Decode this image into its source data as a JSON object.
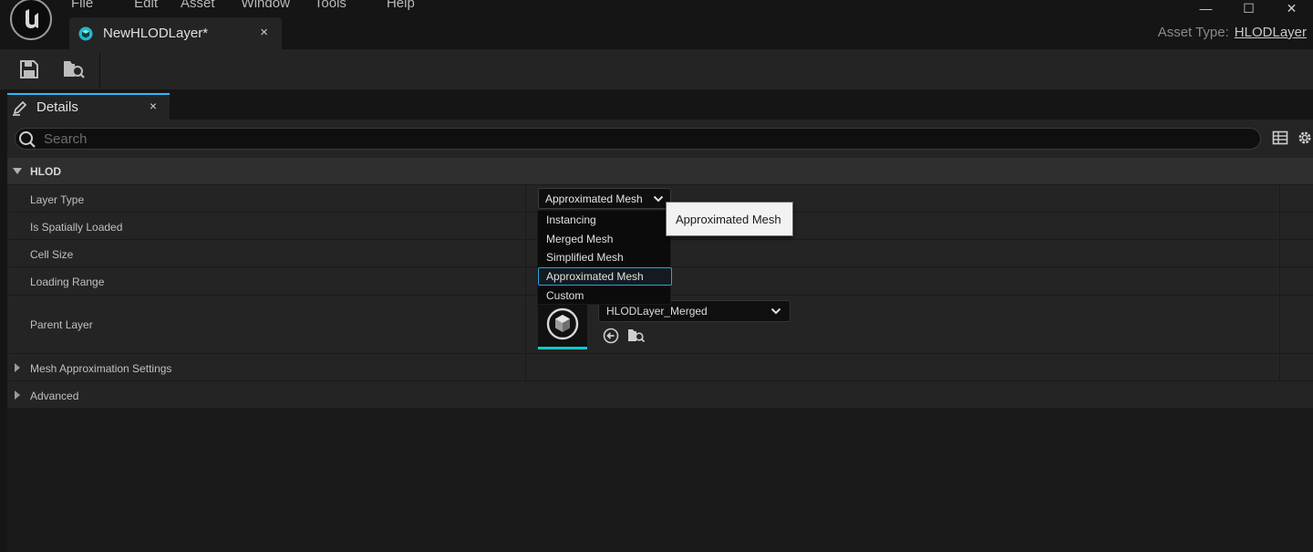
{
  "menu": [
    "File",
    "Edit",
    "Asset",
    "Window",
    "Tools",
    "Help"
  ],
  "document_tab": {
    "label": "NewHLODLayer*",
    "close": "×"
  },
  "window_controls": {
    "minimize": "—",
    "maximize": "☐",
    "close": "✕"
  },
  "asset_type": {
    "label": "Asset Type:",
    "value": "HLODLayer"
  },
  "details_tab": {
    "label": "Details",
    "close": "×"
  },
  "search": {
    "placeholder": "Search",
    "value": ""
  },
  "category": {
    "label": "HLOD"
  },
  "properties": {
    "layer_type": {
      "label": "Layer Type",
      "value": "Approximated Mesh"
    },
    "is_spatially_loaded": {
      "label": "Is Spatially Loaded"
    },
    "cell_size": {
      "label": "Cell Size"
    },
    "loading_range": {
      "label": "Loading Range"
    },
    "parent_layer": {
      "label": "Parent Layer",
      "value": "HLODLayer_Merged"
    },
    "mesh_approximation_settings": {
      "label": "Mesh Approximation Settings"
    },
    "advanced": {
      "label": "Advanced"
    }
  },
  "dropdown_options": [
    "Instancing",
    "Merged Mesh",
    "Simplified Mesh",
    "Approximated Mesh",
    "Custom"
  ],
  "dropdown_selected": "Approximated Mesh",
  "tooltip": {
    "text": "Approximated Mesh"
  },
  "colors": {
    "accent": "#26bbff",
    "thumbnail_underline": "#16c8c8",
    "tab_icon": "#22b8c8"
  }
}
